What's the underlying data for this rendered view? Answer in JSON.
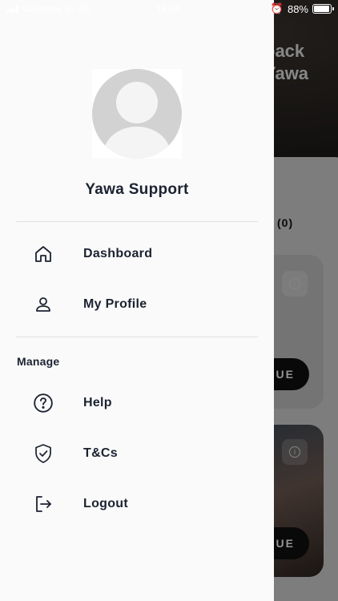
{
  "status_bar": {
    "carrier": "Vodafone IE",
    "network": "4G",
    "time": "14:56",
    "battery_percent": "88%"
  },
  "background": {
    "welcome_text": "back\nYawa",
    "count_text": "(0)",
    "button_text": "UE"
  },
  "drawer": {
    "user_name": "Yawa Support",
    "primary_items": [
      {
        "label": "Dashboard",
        "icon": "home-icon"
      },
      {
        "label": "My Profile",
        "icon": "person-icon"
      }
    ],
    "section_title": "Manage",
    "manage_items": [
      {
        "label": "Help",
        "icon": "help-circle-icon"
      },
      {
        "label": "T&Cs",
        "icon": "shield-check-icon"
      },
      {
        "label": "Logout",
        "icon": "logout-icon"
      }
    ]
  },
  "colors": {
    "drawer_bg": "#fafafa",
    "text_primary": "#1b2230",
    "divider": "#e1e1e1"
  }
}
